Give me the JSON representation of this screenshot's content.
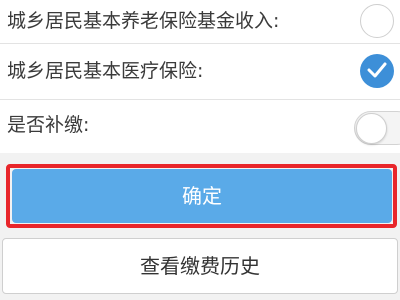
{
  "form": {
    "rows": [
      {
        "label": "城乡居民基本养老保险基金收入:",
        "control": "radio",
        "checked": false
      },
      {
        "label": "城乡居民基本医疗保险:",
        "control": "radio",
        "checked": true
      },
      {
        "label": "是否补缴:",
        "control": "toggle",
        "on": false
      }
    ]
  },
  "buttons": {
    "confirm_label": "确定",
    "history_label": "查看缴费历史"
  },
  "colors": {
    "accent": "#3d8fd8",
    "confirm_bg": "#5aaae8",
    "highlight": "#e8262b"
  }
}
